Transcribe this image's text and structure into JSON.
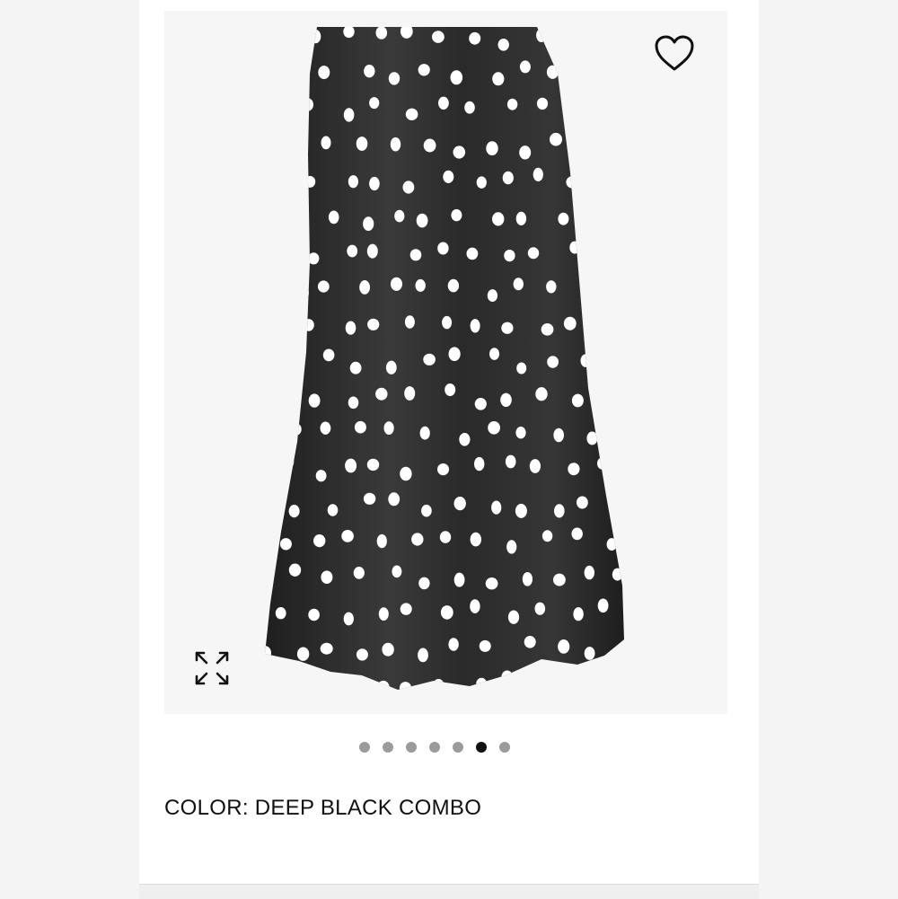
{
  "product": {
    "color_label": "COLOR: DEEP BLACK COMBO",
    "image_alt": "Polka dot satin midi skirt"
  },
  "gallery": {
    "image_count": 7,
    "active_index": 5
  },
  "icons": {
    "favorite": "heart-outline-icon",
    "expand": "expand-arrows-icon"
  },
  "colors": {
    "skirt": "#2b2b2b",
    "polka_dot": "#ffffff",
    "dot_inactive": "#9b9b9b",
    "dot_active": "#111111"
  }
}
